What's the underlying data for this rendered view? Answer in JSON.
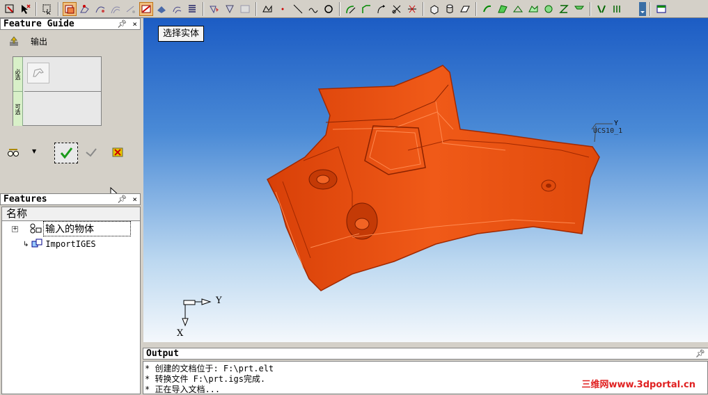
{
  "toolbar": {
    "icons": [
      "select-filter-icon",
      "pick-arrow-icon",
      "select-box-icon",
      "shaded-mode-icon",
      "draw-sketch-icon",
      "curve-tool-icon",
      "loop-icon",
      "trim-icon",
      "edge-select-icon",
      "move-icon",
      "list-icon",
      "transform-icon",
      "fill-icon",
      "grid-icon",
      "polyline-icon",
      "point-icon",
      "line-icon",
      "arc-icon",
      "circle-icon",
      "fillet-icon",
      "chamfer-icon",
      "offset-icon",
      "cut-icon",
      "scissors-icon",
      "box-icon",
      "cylinder-icon",
      "extrude-icon",
      "sweep-icon",
      "surface-icon",
      "patch-icon",
      "blend-icon",
      "loft-icon",
      "section-icon",
      "mirror-icon",
      "parting-icon",
      "overflow-icon",
      "window-icon"
    ]
  },
  "feature_guide": {
    "title": "Feature Guide",
    "pin": "p",
    "close": "×",
    "output_label": "输出",
    "required_tab": "必选",
    "optional_tab": "可选"
  },
  "features": {
    "title": "Features",
    "pin": "p",
    "close": "×",
    "column_header": "名称",
    "items": [
      {
        "label": "输入的物体",
        "expander": "+"
      },
      {
        "label": "ImportIGES"
      }
    ]
  },
  "viewport": {
    "button_label": "选择实体",
    "ucs_label": "UCS10_1",
    "ucs_axis_y": "Y",
    "triad_y": "Y",
    "triad_x": "X",
    "part_color": "#e34a0e"
  },
  "output": {
    "title": "Output",
    "lines": [
      "* 创建的文档位于: F:\\prt.elt",
      "* 转换文件 F:\\prt.igs完成.",
      "* 正在导入文档..."
    ]
  },
  "watermark": "三维网www.3dportal.cn"
}
